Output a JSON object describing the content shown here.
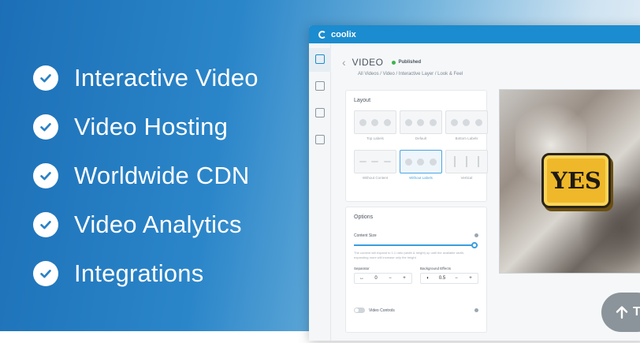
{
  "features": [
    {
      "label": "Interactive Video"
    },
    {
      "label": "Video Hosting"
    },
    {
      "label": "Worldwide CDN"
    },
    {
      "label": "Video Analytics"
    },
    {
      "label": "Integrations"
    }
  ],
  "app": {
    "brand": "coolix",
    "page_title": "VIDEO",
    "status": "Published",
    "breadcrumb": "All Videos  /  Video  /  Interactive Layer  /  Look & Feel"
  },
  "layout_panel": {
    "title": "Layout",
    "options": [
      {
        "label": "Top Labels"
      },
      {
        "label": "Default"
      },
      {
        "label": "Bottom Labels"
      },
      {
        "label": "Without Content"
      },
      {
        "label": "Without Labels"
      },
      {
        "label": "Vertical"
      }
    ],
    "selected_option": "Without Labels"
  },
  "options_panel": {
    "title": "Options",
    "content_size_label": "Content Size",
    "content_size_value": 0.97,
    "hint": "The content will expand to 1:1 ratio (width & height) up until the available width, expanding more will increase only the height",
    "separator_label": "Separator",
    "separator_value": "0",
    "background_effects_label": "Background Effects",
    "background_effects_value": "0.5",
    "video_controls_label": "Video Controls",
    "video_controls_on": false
  },
  "preview": {
    "button_label": "YES"
  },
  "scroll_top": {
    "label": "T"
  },
  "colors": {
    "accent": "#1b8ccf",
    "status_green": "#3bb54a",
    "yes_button": "#efb82a"
  }
}
